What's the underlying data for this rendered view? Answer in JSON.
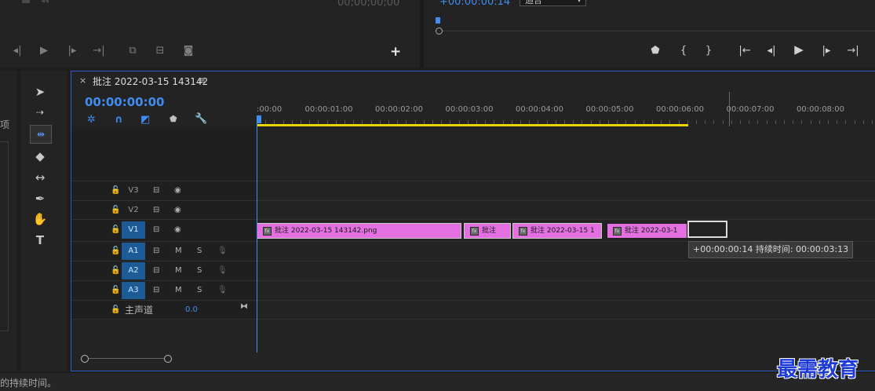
{
  "source_monitor": {
    "timecode": "00;00;00;00",
    "controls": [
      "mark-in-icon",
      "play-icon",
      "mark-out-icon",
      "go-to-out-icon",
      "insert-icon",
      "overwrite-icon",
      "export-frame-icon"
    ],
    "add_label": "+"
  },
  "program_monitor": {
    "timecode": "+00:00:00:14",
    "fit_dropdown": "适合",
    "controls": [
      "marker-icon",
      "mark-in-icon",
      "mark-out-icon",
      "go-to-in-icon",
      "step-back-icon",
      "play-icon",
      "step-forward-icon",
      "go-to-out-icon"
    ]
  },
  "project_panel": {
    "label": "项"
  },
  "timeline": {
    "sequence_title": "批注 2022-03-15 143142",
    "close": "×",
    "menu": "≡",
    "current_time": "00:00:00:00",
    "ruler_labels": [
      ":00:00",
      "00:00:01:00",
      "00:00:02:00",
      "00:00:03:00",
      "00:00:04:00",
      "00:00:05:00",
      "00:00:06:00",
      "00:00:07:00",
      "00:00:08:00"
    ],
    "tracks": [
      {
        "name": "V3",
        "type": "video",
        "targeted": false
      },
      {
        "name": "V2",
        "type": "video",
        "targeted": false
      },
      {
        "name": "V1",
        "type": "video",
        "targeted": true
      },
      {
        "name": "A1",
        "type": "audio",
        "targeted": true
      },
      {
        "name": "A2",
        "type": "audio",
        "targeted": true
      },
      {
        "name": "A3",
        "type": "audio",
        "targeted": true
      }
    ],
    "master": {
      "label": "主声道",
      "value": "0.0"
    },
    "clips": [
      {
        "label": "批注 2022-03-15  143142.png"
      },
      {
        "label": "批注"
      },
      {
        "label": "批注 2022-03-15 1"
      },
      {
        "label": "批注 2022-03-1"
      }
    ],
    "fx_badge": "fx",
    "tooltip": "+00:00:00:14 持续时间: 00:00:03:13",
    "mute_label": "M",
    "solo_label": "S"
  },
  "status_bar": {
    "text": "的持续时间。"
  },
  "watermark": "最需教育"
}
